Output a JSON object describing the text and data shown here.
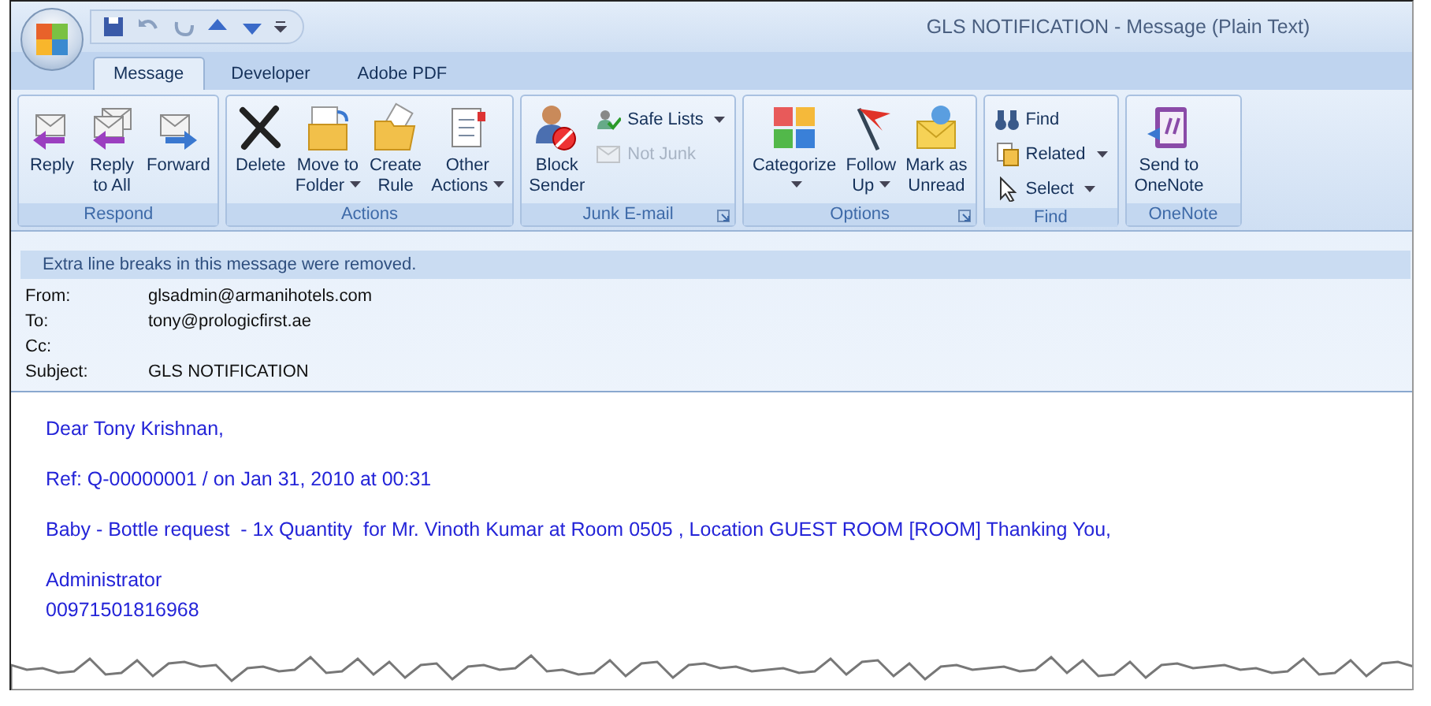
{
  "window": {
    "title": "GLS NOTIFICATION - Message (Plain Text)"
  },
  "tabs": [
    {
      "label": "Message",
      "selected": true
    },
    {
      "label": "Developer",
      "selected": false
    },
    {
      "label": "Adobe PDF",
      "selected": false
    }
  ],
  "ribbon": {
    "groups": [
      {
        "label": "Respond",
        "dialog_launcher": false,
        "buttons": [
          {
            "kind": "large",
            "lines": [
              "Reply"
            ],
            "dropdown": false,
            "disabled": false
          },
          {
            "kind": "large",
            "lines": [
              "Reply",
              "to All"
            ],
            "dropdown": false,
            "disabled": false
          },
          {
            "kind": "large",
            "lines": [
              "Forward"
            ],
            "dropdown": false,
            "disabled": false
          }
        ]
      },
      {
        "label": "Actions",
        "dialog_launcher": false,
        "buttons": [
          {
            "kind": "large",
            "lines": [
              "Delete"
            ],
            "dropdown": false,
            "disabled": false
          },
          {
            "kind": "large",
            "lines": [
              "Move to",
              "Folder"
            ],
            "dropdown": true,
            "disabled": false
          },
          {
            "kind": "large",
            "lines": [
              "Create",
              "Rule"
            ],
            "dropdown": false,
            "disabled": false
          },
          {
            "kind": "large",
            "lines": [
              "Other",
              "Actions"
            ],
            "dropdown": true,
            "disabled": false
          }
        ]
      },
      {
        "label": "Junk E-mail",
        "dialog_launcher": true,
        "buttons": [
          {
            "kind": "large",
            "lines": [
              "Block",
              "Sender"
            ],
            "dropdown": false,
            "disabled": false
          },
          {
            "kind": "small",
            "lines": [
              "Safe Lists"
            ],
            "dropdown": true,
            "disabled": false
          },
          {
            "kind": "small",
            "lines": [
              "Not Junk"
            ],
            "dropdown": false,
            "disabled": true
          }
        ]
      },
      {
        "label": "Options",
        "dialog_launcher": true,
        "buttons": [
          {
            "kind": "large",
            "lines": [
              "Categorize"
            ],
            "dropdown": true,
            "disabled": false
          },
          {
            "kind": "large",
            "lines": [
              "Follow",
              "Up"
            ],
            "dropdown": true,
            "disabled": false
          },
          {
            "kind": "large",
            "lines": [
              "Mark as",
              "Unread"
            ],
            "dropdown": false,
            "disabled": false
          }
        ]
      },
      {
        "label": "Find",
        "dialog_launcher": false,
        "buttons": [
          {
            "kind": "small",
            "lines": [
              "Find"
            ],
            "dropdown": false,
            "disabled": false
          },
          {
            "kind": "small",
            "lines": [
              "Related"
            ],
            "dropdown": true,
            "disabled": false
          },
          {
            "kind": "small",
            "lines": [
              "Select"
            ],
            "dropdown": true,
            "disabled": false
          }
        ]
      },
      {
        "label": "OneNote",
        "dialog_launcher": false,
        "buttons": [
          {
            "kind": "large",
            "lines": [
              "Send to",
              "OneNote"
            ],
            "dropdown": false,
            "disabled": false
          }
        ]
      }
    ]
  },
  "info_bar": "Extra line breaks in this message were removed.",
  "header_fields": [
    {
      "label": "From:",
      "value": "glsadmin@armanihotels.com"
    },
    {
      "label": "To:",
      "value": "tony@prologicfirst.ae"
    },
    {
      "label": "Cc:"
    },
    {
      "label": "Subject:",
      "value": "GLS NOTIFICATION"
    }
  ],
  "body": [
    [
      "Dear Tony Krishnan,"
    ],
    [
      "Ref: Q-00000001 / on Jan 31, 2010 at 00:31"
    ],
    [
      "Baby - Bottle request  - 1x Quantity  for Mr. Vinoth Kumar at Room 0505 , Location GUEST ROOM [ROOM] Thanking You,"
    ],
    [
      "Administrator",
      "00971501816968"
    ]
  ]
}
